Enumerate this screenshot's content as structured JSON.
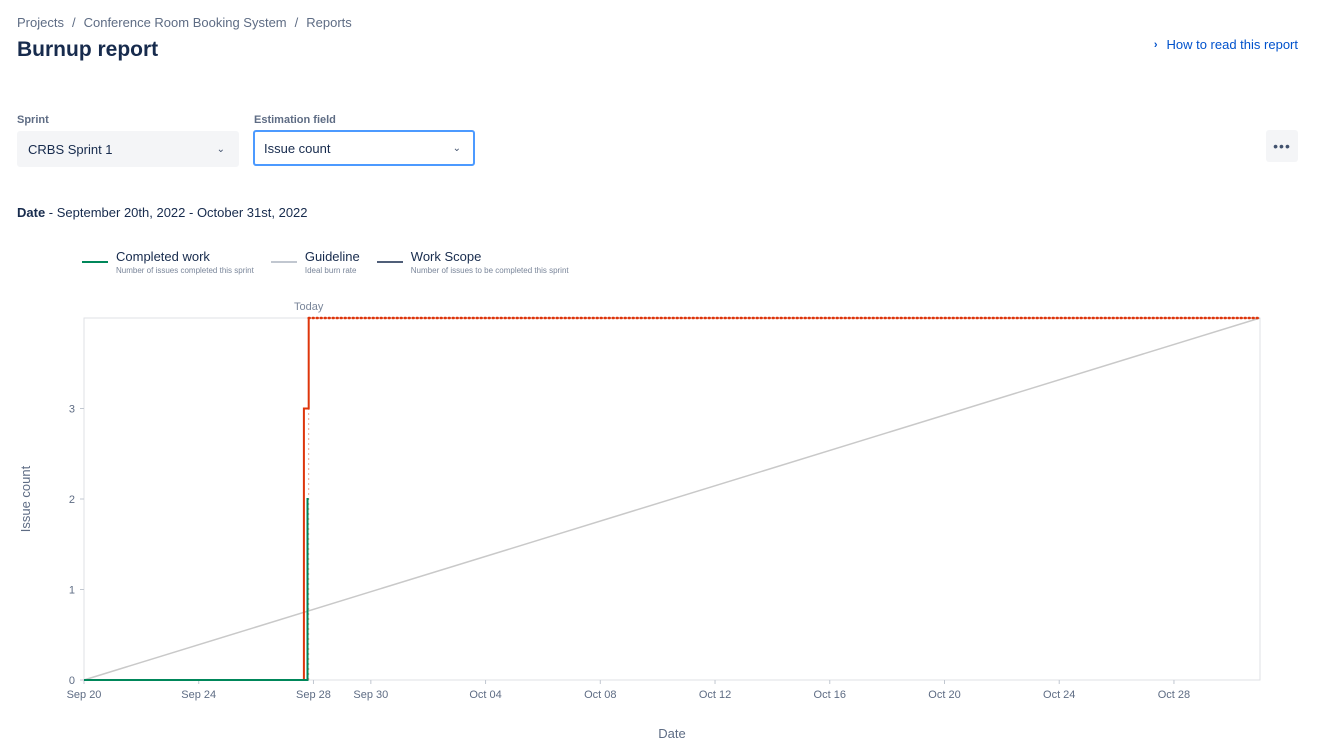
{
  "breadcrumb": {
    "items": [
      "Projects",
      "Conference Room Booking System",
      "Reports"
    ],
    "separator": "/"
  },
  "title": "Burnup report",
  "help_link": "How to read this report",
  "filters": {
    "sprint_label": "Sprint",
    "sprint_value": "CRBS Sprint 1",
    "estimation_label": "Estimation field",
    "estimation_value": "Issue count"
  },
  "more_label": "•••",
  "date_range": {
    "label": "Date",
    "value": " - September 20th, 2022 - October 31st, 2022"
  },
  "legend": [
    {
      "name": "Completed work",
      "desc": "Number of issues completed this sprint",
      "color": "#00875a"
    },
    {
      "name": "Guideline",
      "desc": "Ideal burn rate",
      "color": "#c1c7d0"
    },
    {
      "name": "Work Scope",
      "desc": "Number of issues to be completed this sprint",
      "color": "#505f79"
    }
  ],
  "colors": {
    "completed": "#00875a",
    "guideline": "#c9c9c9",
    "scope": "#de350b",
    "today": "#de350b"
  },
  "chart_data": {
    "type": "line",
    "xlabel": "Date",
    "ylabel": "Issue count",
    "today_label": "Today",
    "x_range": [
      "2022-09-20",
      "2022-10-31"
    ],
    "y_range": [
      0,
      4
    ],
    "x_ticks": [
      {
        "date": "2022-09-20",
        "label": "Sep 20"
      },
      {
        "date": "2022-09-24",
        "label": "Sep 24"
      },
      {
        "date": "2022-09-28",
        "label": "Sep 28"
      },
      {
        "date": "2022-09-30",
        "label": "Sep 30"
      },
      {
        "date": "2022-10-04",
        "label": "Oct 04"
      },
      {
        "date": "2022-10-08",
        "label": "Oct 08"
      },
      {
        "date": "2022-10-12",
        "label": "Oct 12"
      },
      {
        "date": "2022-10-16",
        "label": "Oct 16"
      },
      {
        "date": "2022-10-20",
        "label": "Oct 20"
      },
      {
        "date": "2022-10-24",
        "label": "Oct 24"
      },
      {
        "date": "2022-10-28",
        "label": "Oct 28"
      }
    ],
    "y_ticks": [
      0,
      1,
      2,
      3
    ],
    "today": "2022-09-27T20:00",
    "series": [
      {
        "name": "Work Scope",
        "style": "step",
        "points": [
          [
            "2022-09-20",
            0
          ],
          [
            "2022-09-27T16:00",
            0
          ],
          [
            "2022-09-27T16:00",
            3
          ],
          [
            "2022-09-27T20:00",
            3
          ],
          [
            "2022-09-27T20:00",
            4
          ],
          [
            "2022-10-31",
            4
          ]
        ]
      },
      {
        "name": "Completed work",
        "style": "step",
        "points": [
          [
            "2022-09-20",
            0
          ],
          [
            "2022-09-27T19:00",
            0
          ],
          [
            "2022-09-27T19:00",
            2
          ],
          [
            "2022-09-27T20:00",
            2
          ]
        ]
      },
      {
        "name": "Guideline",
        "style": "linear",
        "points": [
          [
            "2022-09-20",
            0
          ],
          [
            "2022-10-31",
            4
          ]
        ]
      }
    ]
  }
}
